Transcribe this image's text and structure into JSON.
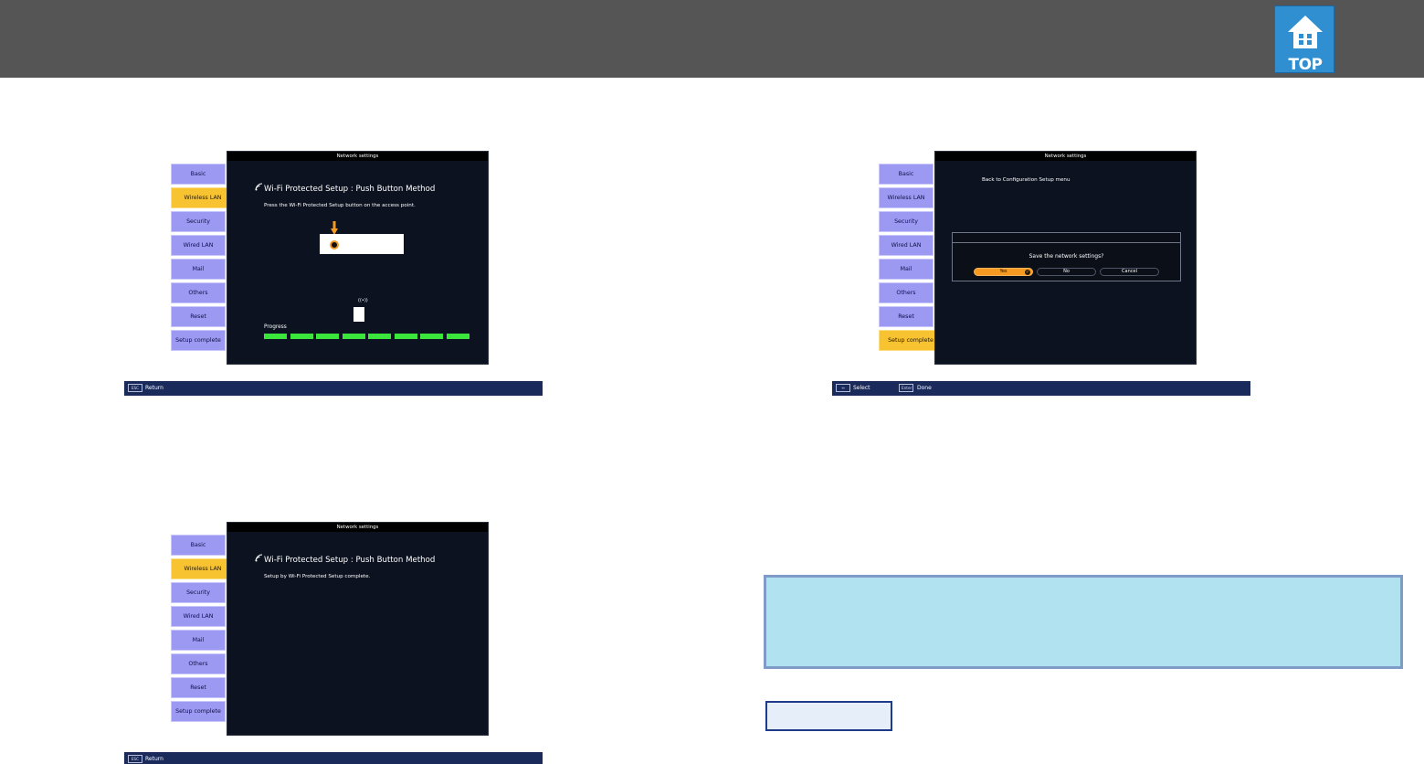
{
  "header": {
    "top_button_label": "TOP"
  },
  "colors": {
    "header_bg": "#555555",
    "menu_item": "#9c99f3",
    "menu_active": "#f7c330",
    "progress": "#3ce53c",
    "dialog_selected": "#f79a22",
    "note_bg": "#b0e2f0"
  },
  "sidebar_items": [
    "Basic",
    "Wireless LAN",
    "Security",
    "Wired LAN",
    "Mail",
    "Others",
    "Reset",
    "Setup complete"
  ],
  "screens": {
    "push_button": {
      "window_title": "Network settings",
      "heading": "Wi-Fi Protected Setup : Push Button Method",
      "instruction": "Press the Wi-Fi Protected Setup button on the access point.",
      "wifi_label": "((•))",
      "progress_label": "Progress",
      "progress_segments_done": 8,
      "progress_segments_total": 8,
      "footer_key": "ESC",
      "footer_label": "Return"
    },
    "complete": {
      "window_title": "Network settings",
      "heading": "Wi-Fi Protected Setup : Push Button Method",
      "message": "Setup by Wi-Fi Protected Setup complete.",
      "footer_key": "ESC",
      "footer_label": "Return"
    },
    "save": {
      "window_title": "Network settings",
      "back_link": "Back to Configuration Setup menu",
      "question": "Save the network settings?",
      "buttons": [
        "Yes",
        "No",
        "Cancel"
      ],
      "footer_select_key": "↔",
      "footer_select_label": "Select",
      "footer_done_key": "Enter",
      "footer_done_label": "Done"
    }
  }
}
